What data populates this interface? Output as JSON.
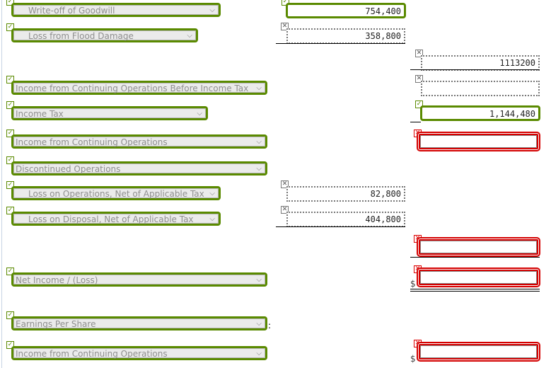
{
  "rows": {
    "r1": {
      "label": "Write-off of Goodwill",
      "value": "754,400",
      "status": "correct"
    },
    "r2": {
      "label": "Loss from Flood Damage",
      "value": "358,800",
      "status": "unmarked"
    },
    "r3": {
      "value": "1113200",
      "status": "unmarked"
    },
    "r4": {
      "label": "Income from Continuing Operations Before Income Tax",
      "value": "",
      "status": "unmarked"
    },
    "r5": {
      "label": "Income Tax",
      "value": "1,144,480",
      "status": "correct"
    },
    "r6": {
      "label": "Income from Continuing Operations",
      "value": "",
      "status": "incorrect"
    },
    "r7": {
      "label": "Discontinued Operations"
    },
    "r8": {
      "label": "Loss on Operations, Net of Applicable Tax",
      "value": "82,800",
      "status": "unmarked"
    },
    "r9": {
      "label": "Loss on Disposal, Net of Applicable Tax",
      "value": "404,800",
      "status": "unmarked"
    },
    "r10": {
      "value": "",
      "status": "incorrect"
    },
    "r11": {
      "label": "Net Income / (Loss)",
      "currency": "$",
      "value": "",
      "status": "incorrect"
    },
    "r12": {
      "label": "Earnings Per Share",
      "suffix": ":"
    },
    "r13": {
      "label": "Income from Continuing Operations",
      "currency": "$",
      "value": "",
      "status": "incorrect"
    }
  },
  "icons": {
    "check": "✓",
    "cross": "✕",
    "chevron": "⌄"
  }
}
